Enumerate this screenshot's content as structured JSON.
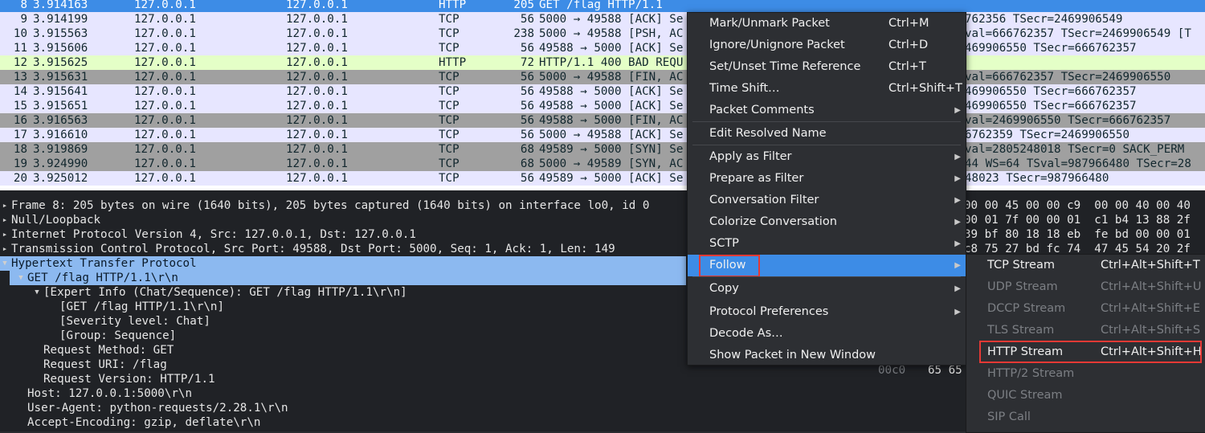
{
  "packets": [
    {
      "no": "8",
      "time": "3.914163",
      "src": "127.0.0.1",
      "dst": "127.0.0.1",
      "proto": "HTTP",
      "len": "205",
      "info": "GET /flag HTTP/1.1",
      "style": "sel"
    },
    {
      "no": "9",
      "time": "3.914199",
      "src": "127.0.0.1",
      "dst": "127.0.0.1",
      "proto": "TCP",
      "len": "56",
      "info": "5000 → 49588 [ACK] Se",
      "style": "tcp"
    },
    {
      "no": "10",
      "time": "3.915563",
      "src": "127.0.0.1",
      "dst": "127.0.0.1",
      "proto": "TCP",
      "len": "238",
      "info": "5000 → 49588 [PSH, AC",
      "style": "tcp"
    },
    {
      "no": "11",
      "time": "3.915606",
      "src": "127.0.0.1",
      "dst": "127.0.0.1",
      "proto": "TCP",
      "len": "56",
      "info": "49588 → 5000 [ACK] Se",
      "style": "tcp"
    },
    {
      "no": "12",
      "time": "3.915625",
      "src": "127.0.0.1",
      "dst": "127.0.0.1",
      "proto": "HTTP",
      "len": "72",
      "info": "HTTP/1.1 400 BAD REQU",
      "style": "http"
    },
    {
      "no": "13",
      "time": "3.915631",
      "src": "127.0.0.1",
      "dst": "127.0.0.1",
      "proto": "TCP",
      "len": "56",
      "info": "5000 → 49588 [FIN, AC",
      "style": "fin"
    },
    {
      "no": "14",
      "time": "3.915641",
      "src": "127.0.0.1",
      "dst": "127.0.0.1",
      "proto": "TCP",
      "len": "56",
      "info": "49588 → 5000 [ACK] Se",
      "style": "tcp"
    },
    {
      "no": "15",
      "time": "3.915651",
      "src": "127.0.0.1",
      "dst": "127.0.0.1",
      "proto": "TCP",
      "len": "56",
      "info": "49588 → 5000 [ACK] Se",
      "style": "tcp"
    },
    {
      "no": "16",
      "time": "3.916563",
      "src": "127.0.0.1",
      "dst": "127.0.0.1",
      "proto": "TCP",
      "len": "56",
      "info": "49588 → 5000 [FIN, AC",
      "style": "fin"
    },
    {
      "no": "17",
      "time": "3.916610",
      "src": "127.0.0.1",
      "dst": "127.0.0.1",
      "proto": "TCP",
      "len": "56",
      "info": "5000 → 49588 [ACK] Se",
      "style": "tcp"
    },
    {
      "no": "18",
      "time": "3.919869",
      "src": "127.0.0.1",
      "dst": "127.0.0.1",
      "proto": "TCP",
      "len": "68",
      "info": "49589 → 5000 [SYN] Se",
      "style": "fin"
    },
    {
      "no": "19",
      "time": "3.924990",
      "src": "127.0.0.1",
      "dst": "127.0.0.1",
      "proto": "TCP",
      "len": "68",
      "info": "5000 → 49589 [SYN, AC",
      "style": "fin"
    },
    {
      "no": "20",
      "time": "3.925012",
      "src": "127.0.0.1",
      "dst": "127.0.0.1",
      "proto": "TCP",
      "len": "56",
      "info": "49589 → 5000 [ACK] Se",
      "style": "tcp"
    }
  ],
  "packet_info_tail": [
    "",
    "762356 TSecr=2469906549",
    "val=666762357 TSecr=2469906549 [T",
    "469906550 TSecr=666762357",
    "",
    "val=666762357 TSecr=2469906550",
    "469906550 TSecr=666762357",
    "469906550 TSecr=666762357",
    "val=2469906550 TSecr=666762357",
    "6762359 TSecr=2469906550",
    "val=2805248018 TSecr=0 SACK_PERM",
    "44 WS=64 TSval=987966480 TSecr=28",
    "48023 TSecr=987966480"
  ],
  "details": [
    {
      "text": "Frame 8: 205 bytes on wire (1640 bits), 205 bytes captured (1640 bits) on interface lo0, id 0",
      "indent": 0,
      "arrow": "right"
    },
    {
      "text": "Null/Loopback",
      "indent": 0,
      "arrow": "right"
    },
    {
      "text": "Internet Protocol Version 4, Src: 127.0.0.1, Dst: 127.0.0.1",
      "indent": 0,
      "arrow": "right"
    },
    {
      "text": "Transmission Control Protocol, Src Port: 49588, Dst Port: 5000, Seq: 1, Ack: 1, Len: 149",
      "indent": 0,
      "arrow": "right"
    },
    {
      "text": "Hypertext Transfer Protocol",
      "indent": 0,
      "arrow": "down",
      "hl": true
    },
    {
      "text": "GET /flag HTTP/1.1\\r\\n",
      "indent": 1,
      "arrow": "down",
      "hl": true
    },
    {
      "text": "[Expert Info (Chat/Sequence): GET /flag HTTP/1.1\\r\\n]",
      "indent": 2,
      "arrow": "down"
    },
    {
      "text": "[GET /flag HTTP/1.1\\r\\n]",
      "indent": 3,
      "arrow": ""
    },
    {
      "text": "[Severity level: Chat]",
      "indent": 3,
      "arrow": ""
    },
    {
      "text": "[Group: Sequence]",
      "indent": 3,
      "arrow": ""
    },
    {
      "text": "Request Method: GET",
      "indent": 2,
      "arrow": ""
    },
    {
      "text": "Request URI: /flag",
      "indent": 2,
      "arrow": ""
    },
    {
      "text": "Request Version: HTTP/1.1",
      "indent": 2,
      "arrow": ""
    },
    {
      "text": "Host: 127.0.0.1:5000\\r\\n",
      "indent": 1,
      "arrow": ""
    },
    {
      "text": "User-Agent: python-requests/2.28.1\\r\\n",
      "indent": 1,
      "arrow": ""
    },
    {
      "text": "Accept-Encoding: gzip, deflate\\r\\n",
      "indent": 1,
      "arrow": ""
    }
  ],
  "bytes": [
    "00 00 45 00 00 c9  00 00 40 00 40",
    "00 01 7f 00 00 01  c1 b4 13 88 2f",
    "39 bf 80 18 18 eb  fe bd 00 00 01",
    "c8 75 27 bd fc 74  47 45 54 20 2f"
  ],
  "bytes_last_offset": "00c0",
  "bytes_last_values": "65 65",
  "menu": {
    "items": [
      {
        "label": "Mark/Unmark Packet",
        "shortcut": "Ctrl+M",
        "sub": false
      },
      {
        "label": "Ignore/Unignore Packet",
        "shortcut": "Ctrl+D",
        "sub": false
      },
      {
        "label": "Set/Unset Time Reference",
        "shortcut": "Ctrl+T",
        "sub": false
      },
      {
        "label": "Time Shift…",
        "shortcut": "Ctrl+Shift+T",
        "sub": false
      },
      {
        "label": "Packet Comments",
        "shortcut": "",
        "sub": true
      },
      {
        "label": "Edit Resolved Name",
        "shortcut": "",
        "sub": false
      },
      {
        "label": "Apply as Filter",
        "shortcut": "",
        "sub": true
      },
      {
        "label": "Prepare as Filter",
        "shortcut": "",
        "sub": true
      },
      {
        "label": "Conversation Filter",
        "shortcut": "",
        "sub": true
      },
      {
        "label": "Colorize Conversation",
        "shortcut": "",
        "sub": true
      },
      {
        "label": "SCTP",
        "shortcut": "",
        "sub": true
      },
      {
        "label": "Follow",
        "shortcut": "",
        "sub": true,
        "active": true
      },
      {
        "label": "Copy",
        "shortcut": "",
        "sub": true
      },
      {
        "label": "Protocol Preferences",
        "shortcut": "",
        "sub": true
      },
      {
        "label": "Decode As…",
        "shortcut": "",
        "sub": false
      },
      {
        "label": "Show Packet in New Window",
        "shortcut": "",
        "sub": false
      }
    ]
  },
  "submenu": {
    "items": [
      {
        "label": "TCP Stream",
        "shortcut": "Ctrl+Alt+Shift+T",
        "enabled": true
      },
      {
        "label": "UDP Stream",
        "shortcut": "Ctrl+Alt+Shift+U",
        "enabled": false
      },
      {
        "label": "DCCP Stream",
        "shortcut": "Ctrl+Alt+Shift+E",
        "enabled": false
      },
      {
        "label": "TLS Stream",
        "shortcut": "Ctrl+Alt+Shift+S",
        "enabled": false
      },
      {
        "label": "HTTP Stream",
        "shortcut": "Ctrl+Alt+Shift+H",
        "enabled": true,
        "boxed": true
      },
      {
        "label": "HTTP/2 Stream",
        "shortcut": "",
        "enabled": false
      },
      {
        "label": "QUIC Stream",
        "shortcut": "",
        "enabled": false
      },
      {
        "label": "SIP Call",
        "shortcut": "",
        "enabled": false
      }
    ]
  },
  "colors": {
    "selection": "#3d8ce6",
    "tcp_row": "#e7e6ff",
    "http_row": "#e4ffc7",
    "fin_row": "#a0a0a0",
    "highlight_box": "#e53935"
  }
}
